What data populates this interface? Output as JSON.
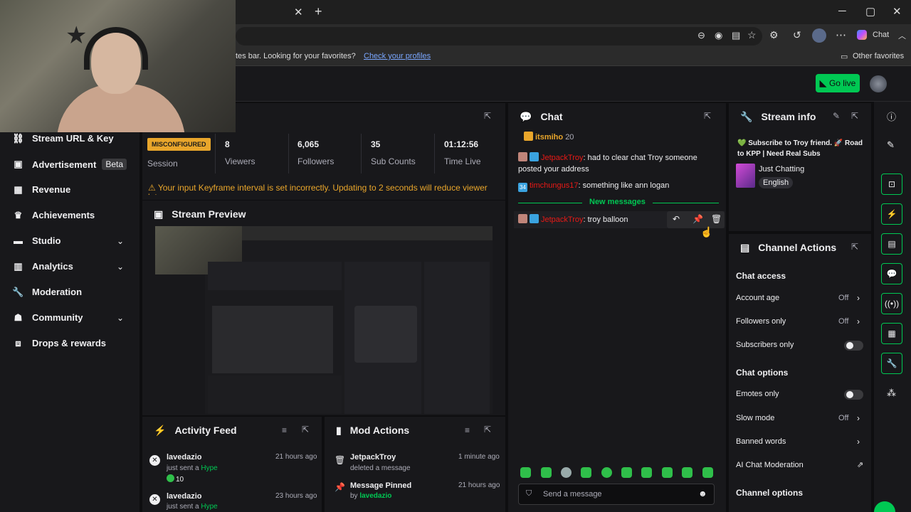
{
  "browser": {
    "fav_notice": "tes bar. Looking for your favorites?",
    "fav_link": "Check your profiles",
    "other_favorites": "Other favorites",
    "copilot_label": "Chat"
  },
  "topbar": {
    "go_live": "Go live"
  },
  "nav": {
    "items": [
      {
        "label": "Stream URL & Key",
        "icon": "link-icon"
      },
      {
        "label": "Advertisement",
        "badge": "Beta",
        "icon": "ad-icon"
      },
      {
        "label": "Revenue",
        "icon": "revenue-icon"
      },
      {
        "label": "Achievements",
        "icon": "trophy-icon"
      },
      {
        "label": "Studio",
        "icon": "studio-icon"
      },
      {
        "label": "Analytics",
        "icon": "analytics-icon"
      },
      {
        "label": "Moderation",
        "icon": "wrench-icon"
      },
      {
        "label": "Community",
        "icon": "community-icon"
      },
      {
        "label": "Drops & rewards",
        "icon": "drops-icon"
      }
    ]
  },
  "session": {
    "status_badge": "MISCONFIGURED",
    "session_label": "Session",
    "stats": [
      {
        "value": "8",
        "label": "Viewers"
      },
      {
        "value": "6,065",
        "label": "Followers"
      },
      {
        "value": "35",
        "label": "Sub Counts"
      },
      {
        "value": "01:12:56",
        "label": "Time Live"
      }
    ],
    "warning": "Your input Keyframe interval is set incorrectly. Updating to 2 seconds will reduce viewer latency."
  },
  "stream_preview": {
    "title": "Stream Preview"
  },
  "activity_feed": {
    "title": "Activity Feed",
    "items": [
      {
        "name": "lavedazio",
        "action": "just sent a",
        "item": "Hype",
        "amount": "10",
        "time": "21 hours ago"
      },
      {
        "name": "lavedazio",
        "action": "just sent a",
        "item": "Hype",
        "time": "23 hours ago"
      }
    ]
  },
  "mod_actions": {
    "title": "Mod Actions",
    "items": [
      {
        "name": "JetpackTroy",
        "sub": "deleted a message",
        "time": "1 minute ago"
      },
      {
        "name": "Message Pinned",
        "sub_prefix": "by",
        "sub_user": "lavedazio",
        "time": "21 hours ago"
      }
    ]
  },
  "chat": {
    "title": "Chat",
    "messages": [
      {
        "user": "itsmiho",
        "text": "20"
      },
      {
        "user": "JetpackTroy",
        "text": ": had to clear chat Troy someone posted your address"
      },
      {
        "user": "timchungus17",
        "text": ": something like ann logan",
        "badge": "34"
      },
      {
        "user": "JetpackTroy",
        "text": ": troy balloon"
      }
    ],
    "new_messages": "New messages",
    "input_placeholder": "Send a message"
  },
  "stream_info": {
    "title": "Stream info",
    "stream_title": "💚 Subscribe to Troy friend. 🚀 Road to KPP | Need Real Subs",
    "category": "Just Chatting",
    "tag": "English"
  },
  "channel_actions": {
    "title": "Channel Actions",
    "chat_access": "Chat access",
    "rows_access": [
      {
        "label": "Account age",
        "value": "Off"
      },
      {
        "label": "Followers only",
        "value": "Off"
      },
      {
        "label": "Subscribers only"
      }
    ],
    "chat_options": "Chat options",
    "rows_options": [
      {
        "label": "Emotes only"
      },
      {
        "label": "Slow mode",
        "value": "Off"
      },
      {
        "label": "Banned words"
      },
      {
        "label": "AI Chat Moderation"
      }
    ],
    "channel_options": "Channel options"
  },
  "colors": {
    "accent": "#00c853",
    "warning": "#e9a62b",
    "bg": "#0e0e10",
    "panel": "#18181b"
  }
}
